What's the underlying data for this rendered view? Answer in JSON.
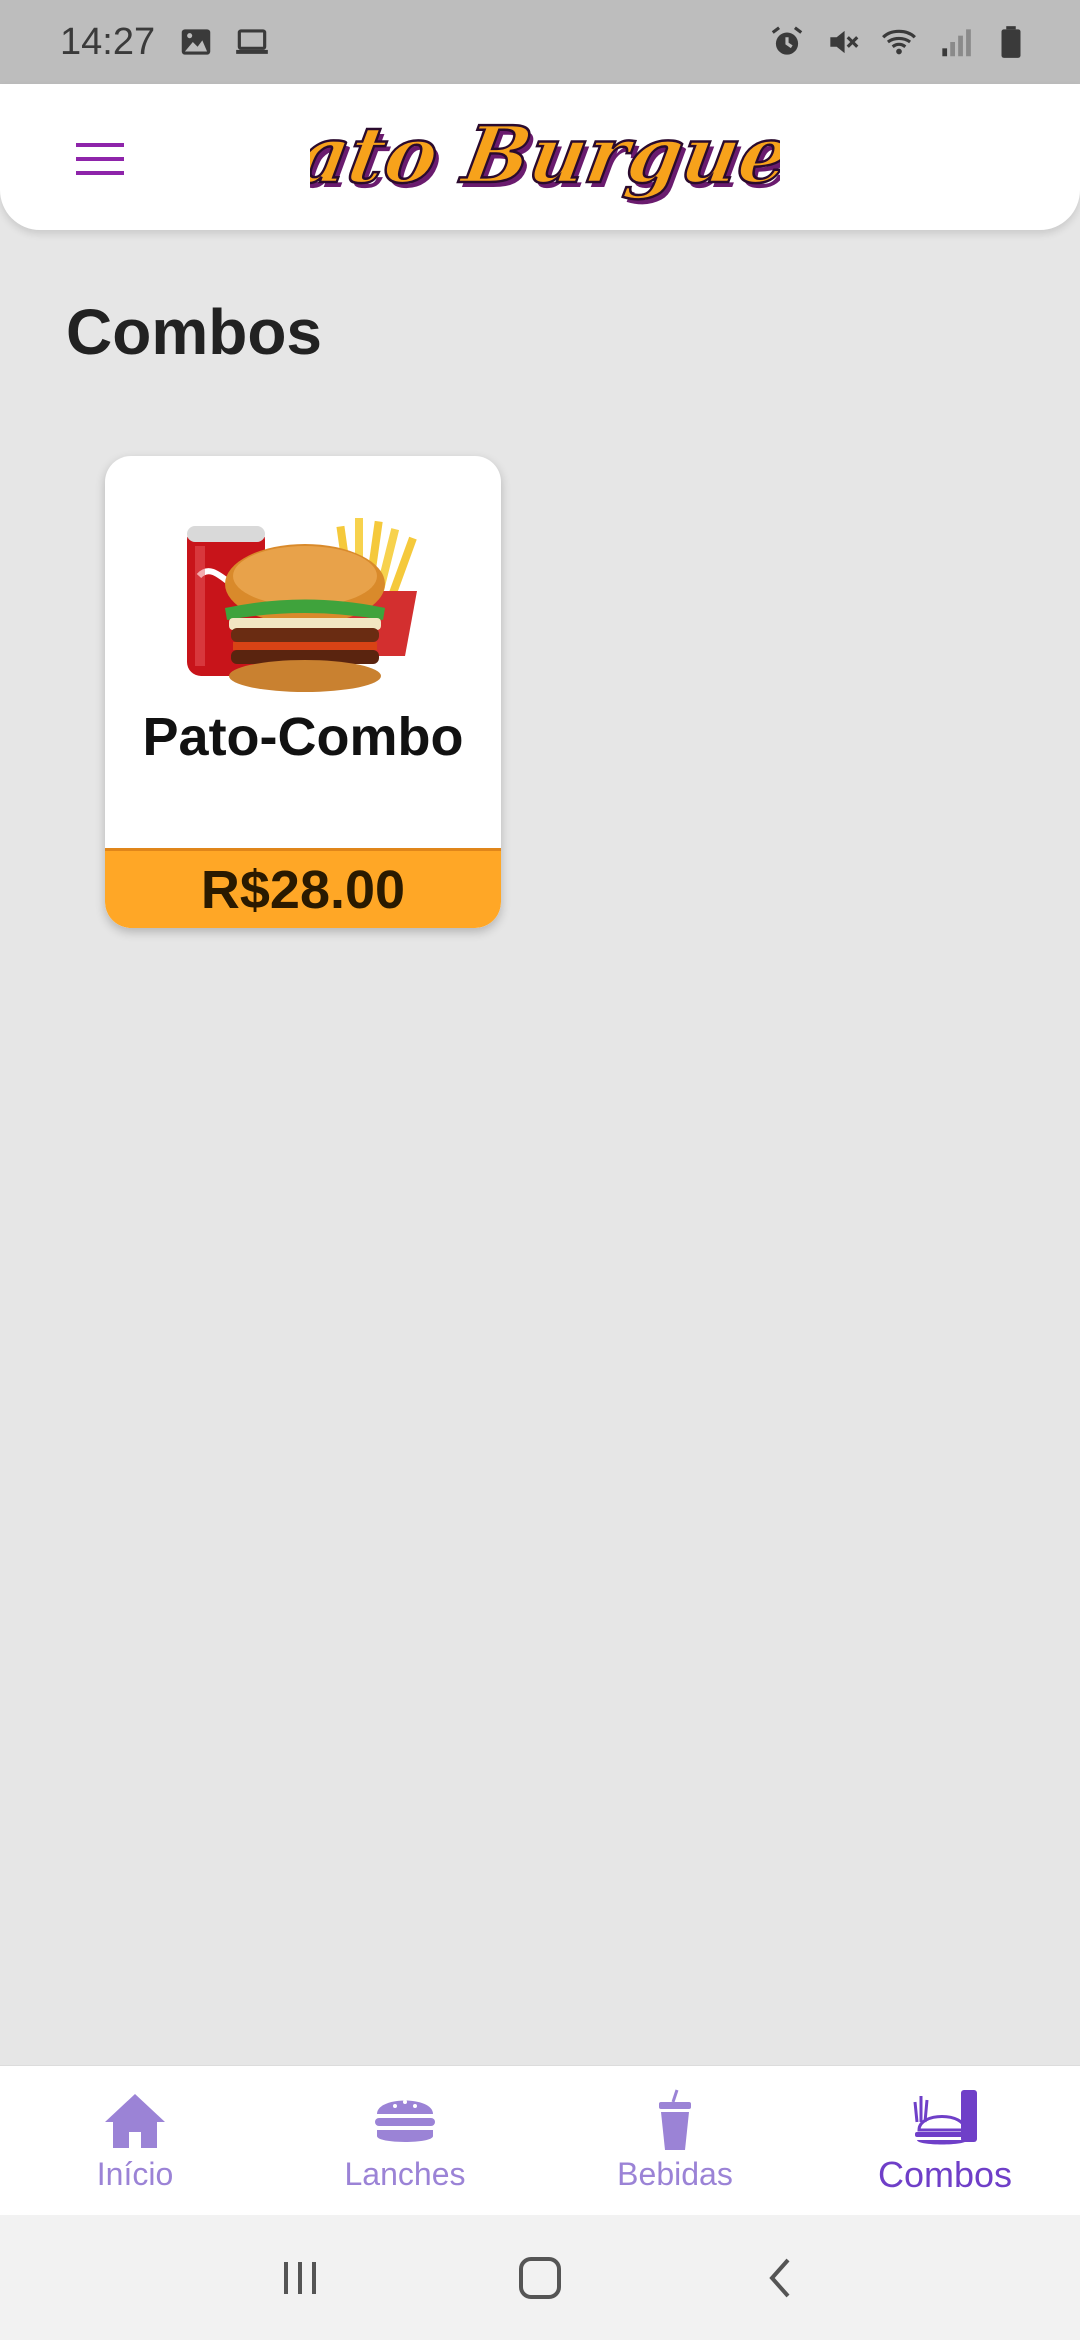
{
  "status_bar": {
    "time": "14:27",
    "left_icons": [
      "image-icon",
      "laptop-icon"
    ],
    "right_icons": [
      "alarm-icon",
      "vibrate-mute-icon",
      "wifi-icon",
      "signal-icon",
      "battery-icon"
    ]
  },
  "app_bar": {
    "logo_text": "Pato Burguer",
    "menu_icon": "hamburger-menu-icon"
  },
  "page": {
    "title": "Combos"
  },
  "products": [
    {
      "name": "Pato-Combo",
      "price": "R$28.00",
      "image": "combo-burger-soda-fries"
    }
  ],
  "bottom_nav": {
    "tabs": [
      {
        "label": "Início",
        "icon": "home-icon",
        "active": false
      },
      {
        "label": "Lanches",
        "icon": "burger-icon",
        "active": false
      },
      {
        "label": "Bebidas",
        "icon": "drink-cup-icon",
        "active": false
      },
      {
        "label": "Combos",
        "icon": "combo-meal-icon",
        "active": true
      }
    ]
  },
  "colors": {
    "accent": "#6f3fc8",
    "inactive_nav": "#9b83d6",
    "price_badge": "#ffa726",
    "logo_fill": "#f7a21b",
    "logo_shadow": "#6a1b6e"
  }
}
